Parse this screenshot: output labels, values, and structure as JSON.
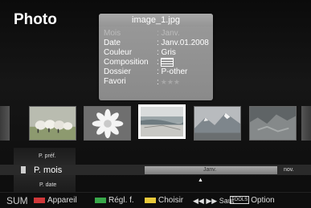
{
  "title": "Photo",
  "info_popup": {
    "filename": "image_1.jpg",
    "rows": [
      {
        "label": "Mois",
        "value": ": Janv.",
        "dim": true
      },
      {
        "label": "Date",
        "value": ": Janv.01.2008",
        "dim": false
      },
      {
        "label": "Couleur",
        "value": ": Gris",
        "dim": false
      },
      {
        "label": "Composition",
        "value": ":",
        "dim": false
      },
      {
        "label": "Dossier",
        "value": ": P-other",
        "dim": false
      },
      {
        "label": "Favori",
        "value": ":",
        "dim": false
      }
    ],
    "favorite_stars": "★★★"
  },
  "thumbnails": [
    {
      "name": "sheep",
      "selected": false
    },
    {
      "name": "flower",
      "selected": false
    },
    {
      "name": "beach",
      "selected": true
    },
    {
      "name": "mountain",
      "selected": false
    },
    {
      "name": "rocks",
      "selected": false
    }
  ],
  "nav": {
    "prev_category": "P. préf.",
    "current_category": "P. mois",
    "next_category": "P. date",
    "current_month": "Janv.",
    "next_month": "nov.",
    "marker": "▲"
  },
  "statusbar": {
    "sum": "SUM",
    "items": [
      {
        "color": "#d0383a",
        "label": "Appareil"
      },
      {
        "color": "#39a84a",
        "label": "Régl. f."
      },
      {
        "color": "#e8c93a",
        "label": "Choisir"
      }
    ],
    "jump_icon": "◀◀ ▶▶",
    "jump_label": "Saut",
    "tools_badge": "TOOLS",
    "tools_label": "Option"
  },
  "colors": {
    "red": "#d0383a",
    "green": "#39a84a",
    "yellow": "#e8c93a"
  }
}
